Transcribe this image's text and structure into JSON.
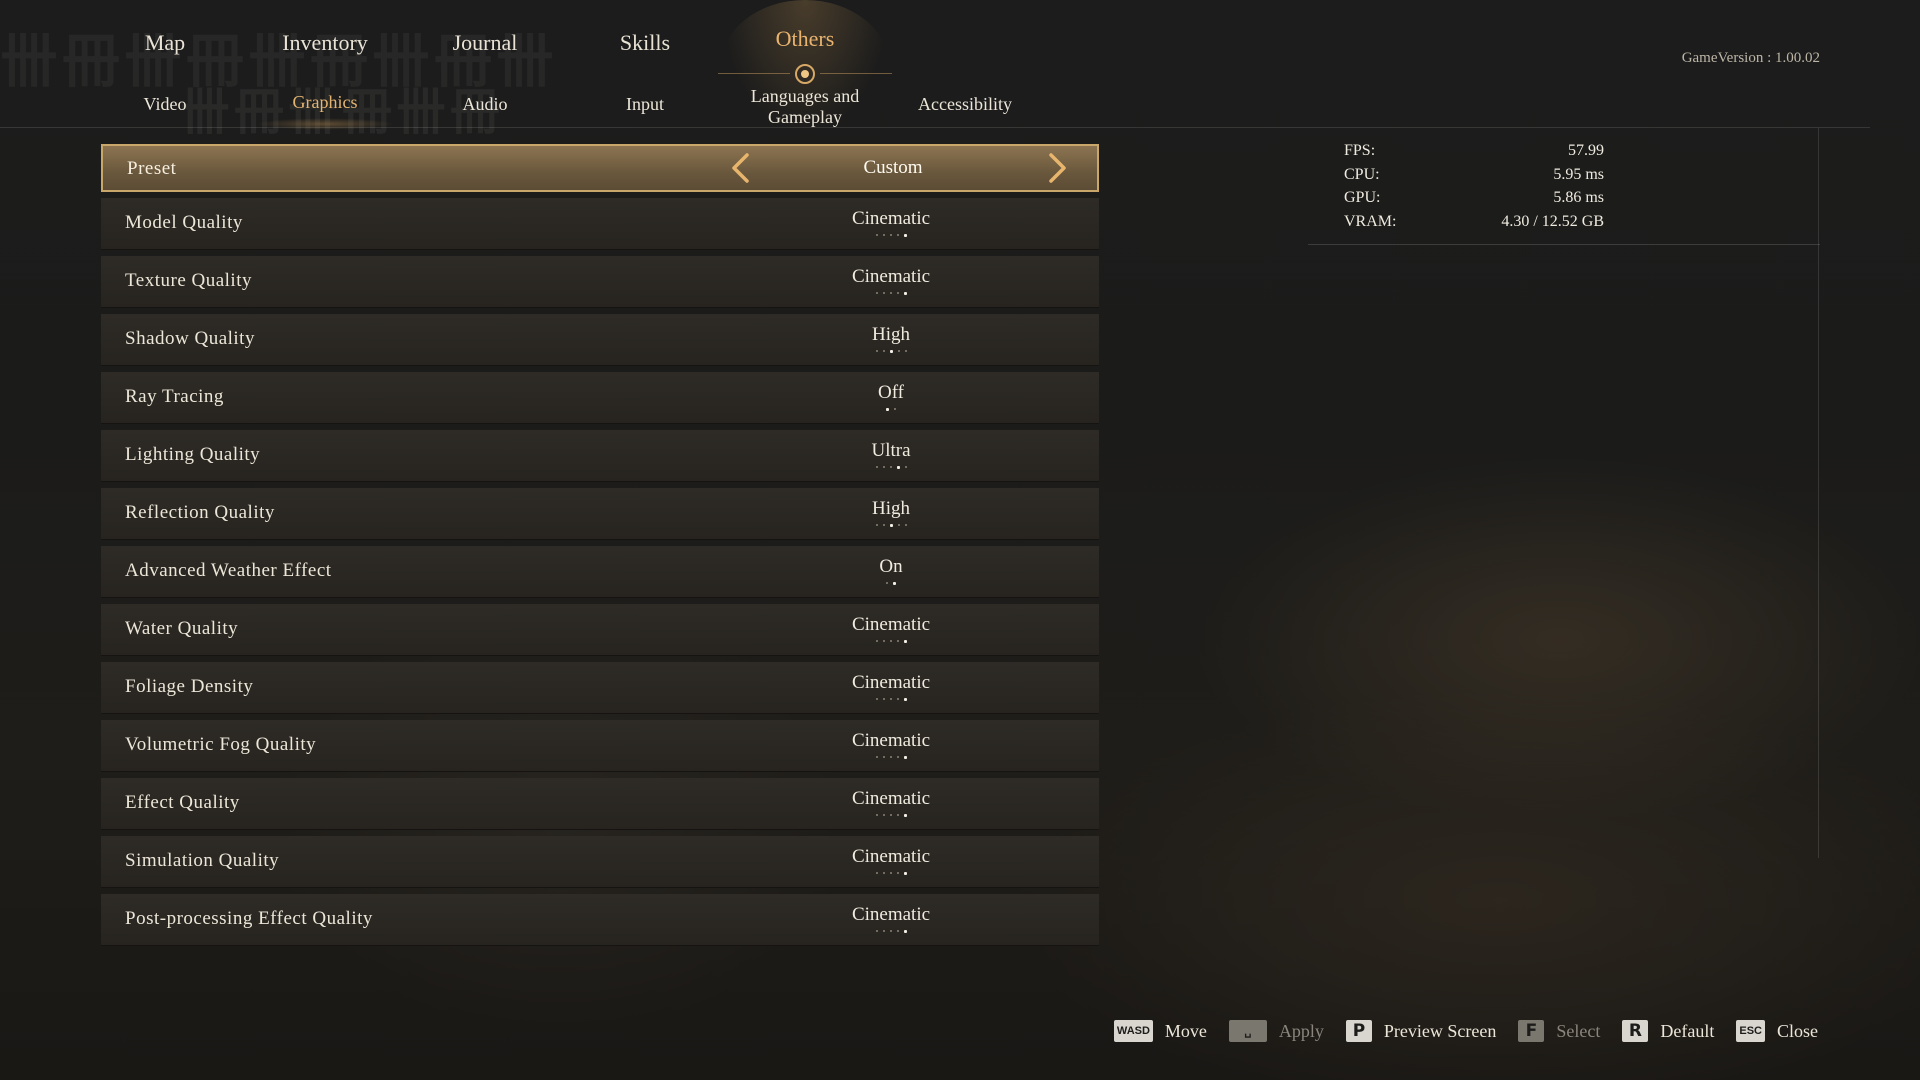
{
  "nav": {
    "top_tabs": [
      "Map",
      "Inventory",
      "Journal",
      "Skills",
      "Others"
    ],
    "active_top": "Others",
    "sub_tabs": [
      "Video",
      "Graphics",
      "Audio",
      "Input",
      "Languages and Gameplay",
      "Accessibility"
    ],
    "sub_tab_lines": {
      "languages_line1": "Languages and",
      "languages_line2": "Gameplay"
    },
    "active_sub": "Graphics"
  },
  "version": "GameVersion : 1.00.02",
  "preset": {
    "label": "Preset",
    "value": "Custom",
    "prev_icon": "chevron-left-icon",
    "next_icon": "chevron-right-icon"
  },
  "settings": [
    {
      "label": "Model Quality",
      "value": "Cinematic",
      "level_index": 4,
      "level_count": 5
    },
    {
      "label": "Texture Quality",
      "value": "Cinematic",
      "level_index": 4,
      "level_count": 5
    },
    {
      "label": "Shadow Quality",
      "value": "High",
      "level_index": 2,
      "level_count": 5
    },
    {
      "label": "Ray Tracing",
      "value": "Off",
      "level_index": 0,
      "level_count": 2
    },
    {
      "label": "Lighting Quality",
      "value": "Ultra",
      "level_index": 3,
      "level_count": 5
    },
    {
      "label": "Reflection Quality",
      "value": "High",
      "level_index": 2,
      "level_count": 5
    },
    {
      "label": "Advanced Weather Effect",
      "value": "On",
      "level_index": 1,
      "level_count": 2
    },
    {
      "label": "Water Quality",
      "value": "Cinematic",
      "level_index": 4,
      "level_count": 5
    },
    {
      "label": "Foliage Density",
      "value": "Cinematic",
      "level_index": 4,
      "level_count": 5
    },
    {
      "label": "Volumetric Fog Quality",
      "value": "Cinematic",
      "level_index": 4,
      "level_count": 5
    },
    {
      "label": "Effect Quality",
      "value": "Cinematic",
      "level_index": 4,
      "level_count": 5
    },
    {
      "label": "Simulation Quality",
      "value": "Cinematic",
      "level_index": 4,
      "level_count": 5
    },
    {
      "label": "Post-processing Effect Quality",
      "value": "Cinematic",
      "level_index": 4,
      "level_count": 5
    }
  ],
  "stats": {
    "fps_label": "FPS:",
    "fps_value": "57.99",
    "cpu_label": "CPU:",
    "cpu_value": "5.95  ms",
    "gpu_label": "GPU:",
    "gpu_value": "5.86  ms",
    "vram_label": "VRAM:",
    "vram_value": "4.30  /  12.52  GB"
  },
  "footer": [
    {
      "key": "WASD",
      "label": "Move",
      "enabled": true
    },
    {
      "key": "␣",
      "label": "Apply",
      "enabled": false
    },
    {
      "key": "P",
      "label": "Preview  Screen",
      "enabled": true
    },
    {
      "key": "F",
      "label": "Select",
      "enabled": false
    },
    {
      "key": "R",
      "label": "Default",
      "enabled": true
    },
    {
      "key": "ESC",
      "label": "Close",
      "enabled": true
    }
  ],
  "colors": {
    "accent": "#e9b36f",
    "preset_bg": "#7a6446",
    "row_bg": "#2b2823",
    "text": "#ece6d8"
  }
}
